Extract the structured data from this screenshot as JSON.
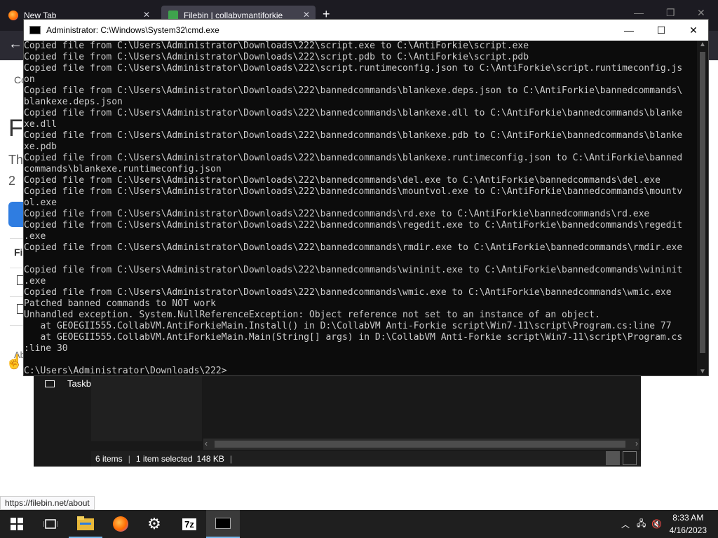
{
  "browser": {
    "tabs": [
      {
        "label": "New Tab",
        "close": "✕"
      },
      {
        "label": "Filebin | collabvmantiforkie",
        "close": "✕"
      }
    ],
    "new_tab": "+",
    "status_url": "https://filebin.net/about",
    "page_fragments": {
      "co": "Co",
      "f": "F",
      "th": "Th",
      "two": "2",
      "fi": "Fi",
      "ab": "Ab"
    }
  },
  "cmd": {
    "title": "Administrator: C:\\Windows\\System32\\cmd.exe",
    "lines": [
      "Copied file from C:\\Users\\Administrator\\Downloads\\222\\script.exe to C:\\AntiForkie\\script.exe",
      "Copied file from C:\\Users\\Administrator\\Downloads\\222\\script.pdb to C:\\AntiForkie\\script.pdb",
      "Copied file from C:\\Users\\Administrator\\Downloads\\222\\script.runtimeconfig.json to C:\\AntiForkie\\script.runtimeconfig.js",
      "on",
      "Copied file from C:\\Users\\Administrator\\Downloads\\222\\bannedcommands\\blankexe.deps.json to C:\\AntiForkie\\bannedcommands\\",
      "blankexe.deps.json",
      "Copied file from C:\\Users\\Administrator\\Downloads\\222\\bannedcommands\\blankexe.dll to C:\\AntiForkie\\bannedcommands\\blanke",
      "xe.dll",
      "Copied file from C:\\Users\\Administrator\\Downloads\\222\\bannedcommands\\blankexe.pdb to C:\\AntiForkie\\bannedcommands\\blanke",
      "xe.pdb",
      "Copied file from C:\\Users\\Administrator\\Downloads\\222\\bannedcommands\\blankexe.runtimeconfig.json to C:\\AntiForkie\\banned",
      "commands\\blankexe.runtimeconfig.json",
      "Copied file from C:\\Users\\Administrator\\Downloads\\222\\bannedcommands\\del.exe to C:\\AntiForkie\\bannedcommands\\del.exe",
      "Copied file from C:\\Users\\Administrator\\Downloads\\222\\bannedcommands\\mountvol.exe to C:\\AntiForkie\\bannedcommands\\mountv",
      "ol.exe",
      "Copied file from C:\\Users\\Administrator\\Downloads\\222\\bannedcommands\\rd.exe to C:\\AntiForkie\\bannedcommands\\rd.exe",
      "Copied file from C:\\Users\\Administrator\\Downloads\\222\\bannedcommands\\regedit.exe to C:\\AntiForkie\\bannedcommands\\regedit",
      ".exe",
      "Copied file from C:\\Users\\Administrator\\Downloads\\222\\bannedcommands\\rmdir.exe to C:\\AntiForkie\\bannedcommands\\rmdir.exe",
      "",
      "Copied file from C:\\Users\\Administrator\\Downloads\\222\\bannedcommands\\wininit.exe to C:\\AntiForkie\\bannedcommands\\wininit",
      ".exe",
      "Copied file from C:\\Users\\Administrator\\Downloads\\222\\bannedcommands\\wmic.exe to C:\\AntiForkie\\bannedcommands\\wmic.exe",
      "Patched banned commands to NOT work",
      "Unhandled exception. System.NullReferenceException: Object reference not set to an instance of an object.",
      "   at GEOEGII555.CollabVM.AntiForkieMain.Install() in D:\\CollabVM Anti-Forkie script\\Win7-11\\script\\Program.cs:line 77",
      "   at GEOEGII555.CollabVM.AntiForkieMain.Main(String[] args) in D:\\CollabVM Anti-Forkie script\\Win7-11\\script\\Program.cs",
      ":line 30",
      "",
      "C:\\Users\\Administrator\\Downloads\\222>"
    ]
  },
  "explorer": {
    "nav_item": "Taskb",
    "items_count": "6 items",
    "selection": "1 item selected",
    "size": "148 KB",
    "sep": "|"
  },
  "taskbar": {
    "clock_time": "8:33 AM",
    "clock_date": "4/16/2023",
    "apps": [
      "start-icon",
      "task-view-icon",
      "file-explorer-icon",
      "firefox-icon",
      "settings-icon",
      "7zip-icon",
      "cmd-icon"
    ],
    "sevenzip_label": "7z"
  },
  "colors": {
    "console_bg": "#0c0c0c",
    "console_text": "#cccccc",
    "taskbar_bg": "#1f1f1f",
    "accent": "#76b9ed"
  }
}
